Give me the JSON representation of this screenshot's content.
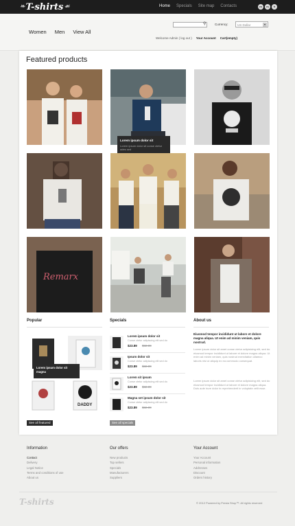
{
  "brand": {
    "logo_text": "T-shirts"
  },
  "topnav": [
    "Home",
    "Specials",
    "Site map",
    "Contacts"
  ],
  "languages": [
    "en",
    "es",
    "fr"
  ],
  "header": {
    "categories": [
      "Women",
      "Men",
      "View All"
    ],
    "currency_label": "Currency:",
    "currency_value": "US Dollar",
    "welcome": "Welcome  Admin  ( log out )",
    "your_account": "Your Account",
    "cart": "Cart(empty)"
  },
  "featured": {
    "title": "Featured products",
    "hover_title": "Lorem ipsum dolor sit",
    "hover_desc": "Lorem ipsum dolor sit conse ctetur ades sed"
  },
  "popular": {
    "title": "Popular",
    "hover": "Lorem ipsum dolor sit magna",
    "button": "See all featured"
  },
  "specials": {
    "title": "Specials",
    "items": [
      {
        "title": "Lorem ipsum dolor sit",
        "desc": "Conse ctetur adipiscing elit sed do",
        "price": "$23.89",
        "old": "$32.89"
      },
      {
        "title": "Ipsum dolor sit",
        "desc": "Conse ctetur adipiscing elit sed do",
        "price": "$23.89",
        "old": "$32.89"
      },
      {
        "title": "Lorem sit ipsum",
        "desc": "Conse ctetur adipiscing elit sed do",
        "price": "$23.89",
        "old": "$32.89"
      },
      {
        "title": "Magna set ipsum dolor sit",
        "desc": "Conse ctetur adipiscing elit sed do",
        "price": "$23.89",
        "old": "$32.89"
      }
    ],
    "button": "See all specials"
  },
  "about": {
    "title": "About us",
    "heading": "Eiusmod tempor incididunt ut labore et dolore magna aliqua. Ut enim ad minim veniam, quis nostrud.",
    "p1": "Lorem ipsum dolor sit amet conse ctetur adipisicing elit, sed do eiusmod tempor incididunt ut labore et dolore magna aliqua. Ut enim ad minim veniam, quis nostrud exercitation ullamco laboris nisi ut aliquip ex ea commodo consequat.",
    "p2": "Lorem ipsum dolor sit amet conse ctetur adipisicing elit, sed do eiusmod tempor incididunt ut labore et dolore magna aliqua. Duis aute irure dolor in reprehenderit in voluptate velit esse."
  },
  "footer": {
    "information": {
      "title": "Information",
      "items": [
        "Contact",
        "Delivery",
        "Legal Notice",
        "Terms and conditions of use",
        "About us"
      ]
    },
    "offers": {
      "title": "Our offers",
      "items": [
        "New products",
        "Top sellers",
        "Specials",
        "Manufacturers",
        "Suppliers"
      ]
    },
    "account": {
      "title": "Your Account",
      "items": [
        "Your Account",
        "Personal information",
        "Addresses",
        "Discount",
        "Orders history"
      ]
    },
    "logo_text": "T-shirts",
    "copyright": "© 2012 Powered by Presta Shop™. All rights reserved"
  },
  "colors": {
    "topbar": "#1d1d1d",
    "accent_dark": "#2a2a2a",
    "button_grey": "#8a8a8a"
  }
}
